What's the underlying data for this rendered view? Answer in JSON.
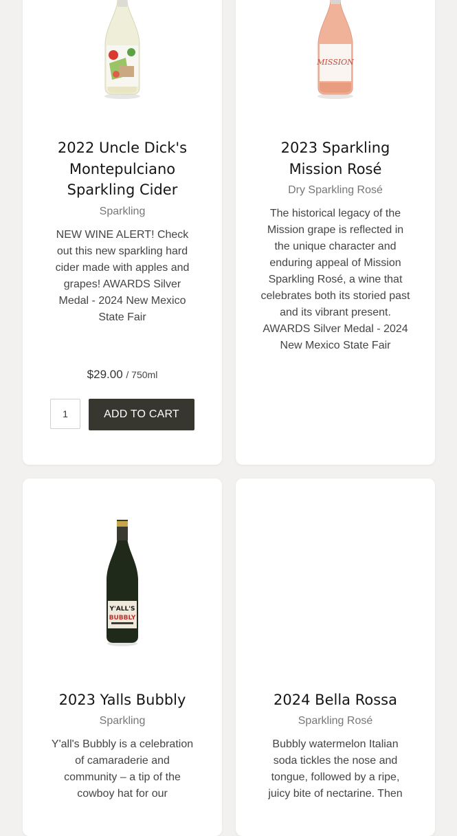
{
  "products": [
    {
      "title": "2022 Uncle Dick's Montepulciano Sparkling Cider",
      "category": "Sparkling",
      "description": "NEW WINE ALERT! Check out this new sparkling hard cider made with apples and grapes!   AWARDS Silver Medal - 2024 New Mexico State Fair",
      "price": "$29.00",
      "size": "/ 750ml",
      "quantity": "1",
      "add_to_cart_label": "ADD TO CART"
    },
    {
      "title": "2023 Sparkling Mission Rosé",
      "category": "Dry Sparkling Rosé",
      "description": "The historical legacy of the Mission grape is reflected in the unique character and enduring appeal of Mission Sparkling Rosé, a wine that celebrates both its storied past and its vibrant present.   AWARDS Silver Medal - 2024 New Mexico State Fair"
    },
    {
      "title": "2023 Yalls Bubbly",
      "category": "Sparkling",
      "description": "Y'all's Bubbly is a celebration of camaraderie and community – a tip of the cowboy hat for our"
    },
    {
      "title": "2024 Bella Rossa",
      "category": "Sparkling Rosé",
      "description": "Bubbly watermelon Italian soda tickles the nose and tongue, followed by a ripe, juicy bite of nectarine. Then"
    }
  ],
  "images": {
    "bottle1": "sparkling-cider-bottle",
    "bottle2": "rose-bottle-mission-label",
    "bottle3": "yalls-bubbly-bottle"
  },
  "colors": {
    "button": "#37372f",
    "background": "#f2f1ef",
    "card": "#ffffff"
  }
}
